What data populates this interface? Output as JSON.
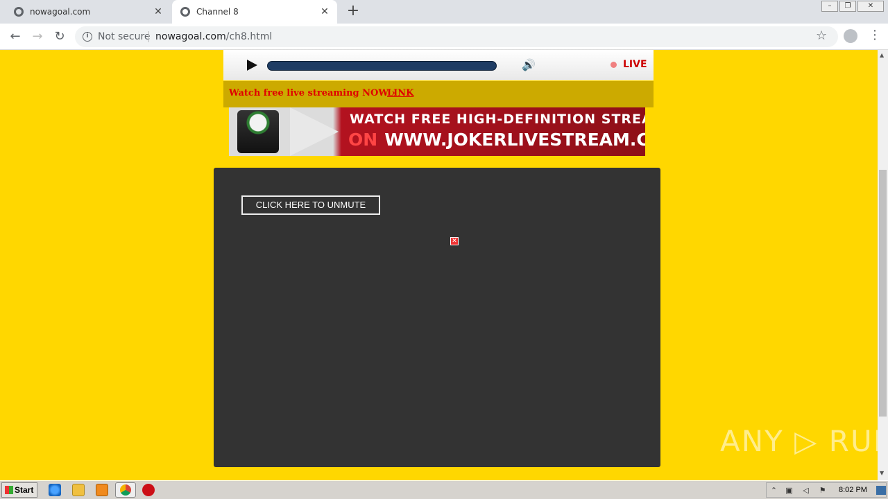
{
  "browser": {
    "tabs": [
      {
        "title": "nowagoal.com",
        "active": false
      },
      {
        "title": "Channel 8",
        "active": true
      }
    ],
    "new_tab_label": "+",
    "close_glyph": "✕",
    "window_controls": [
      "–",
      "❐",
      "✕"
    ],
    "nav": {
      "back": "←",
      "forward": "→",
      "reload": "↻"
    },
    "security_label": "Not secure",
    "url_host": "nowagoal.com",
    "url_path": "/ch8.html",
    "star_glyph": "☆",
    "menu_glyph": "⋮"
  },
  "player": {
    "live_label": "LIVE",
    "volume_glyph": "🔊",
    "progress": 1.0
  },
  "promo": {
    "text": "Watch free live streaming NOW ›",
    "link_label": "LINK"
  },
  "banner": {
    "line1": "WATCH FREE HIGH-DEFINITION STREAMS",
    "line2_prefix": "ON",
    "line2_url": "WWW.JOKERLIVESTREAM.COM"
  },
  "video": {
    "unmute_label": "CLICK HERE TO UNMUTE",
    "broken_image_glyph": "✕"
  },
  "watermark": "ANY ▷ RUN",
  "taskbar": {
    "start_label": "Start",
    "clock": "8:02 PM",
    "pinned": [
      "ie-icon",
      "explorer-icon",
      "media-player-icon",
      "chrome-icon",
      "opera-icon"
    ]
  },
  "colors": {
    "page_bg": "#ffd700",
    "promo_bar": "#ccaa00",
    "promo_text": "#e00000",
    "video_bg": "#333333",
    "live_red": "#cc0000"
  }
}
